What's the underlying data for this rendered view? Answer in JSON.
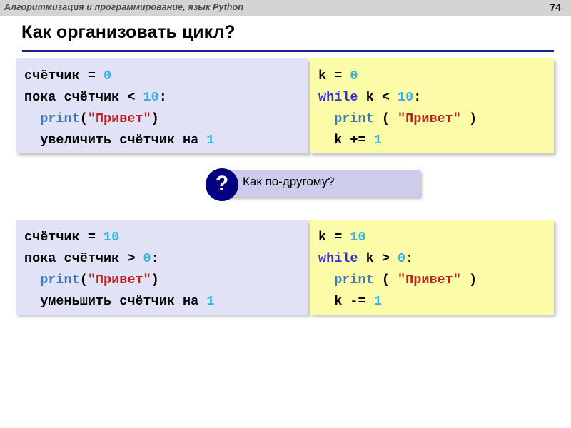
{
  "header": {
    "course": "Алгоритмизация и программирование, язык Python",
    "slide_number": "74"
  },
  "title": "Как организовать цикл?",
  "colors": {
    "header_bar": "#d4d4d4",
    "title_rule": "#1c1c8c",
    "pseudo_panel_bg": "#e2e2f7",
    "python_panel_bg": "#fbfba8",
    "badge_bg": "#000080",
    "bubble_bg": "#ccccec",
    "number_token": "#33b5e6",
    "keyword_token": "#3333cc",
    "function_token": "#3b7bbf",
    "string_token": "#c02020"
  },
  "callout": {
    "badge_glyph": "?",
    "text": "Как по-другому?"
  },
  "panels": {
    "pseudo_top": {
      "lines": [
        [
          {
            "t": "счётчик = ",
            "c": "plain"
          },
          {
            "t": "0",
            "c": "num"
          }
        ],
        [
          {
            "t": "пока счётчик < ",
            "c": "plain"
          },
          {
            "t": "10",
            "c": "num"
          },
          {
            "t": ":",
            "c": "plain"
          }
        ],
        [
          {
            "t": "  ",
            "c": "plain"
          },
          {
            "t": "print",
            "c": "fn"
          },
          {
            "t": "(",
            "c": "plain"
          },
          {
            "t": "\"Привет\"",
            "c": "str"
          },
          {
            "t": ")",
            "c": "plain"
          }
        ],
        [
          {
            "t": "  увеличить счётчик на ",
            "c": "plain"
          },
          {
            "t": "1",
            "c": "num"
          }
        ]
      ]
    },
    "python_top": {
      "lines": [
        [
          {
            "t": "k = ",
            "c": "plain"
          },
          {
            "t": "0",
            "c": "num"
          }
        ],
        [
          {
            "t": "while",
            "c": "kw"
          },
          {
            "t": " k < ",
            "c": "plain"
          },
          {
            "t": "10",
            "c": "num"
          },
          {
            "t": ":",
            "c": "plain"
          }
        ],
        [
          {
            "t": "  ",
            "c": "plain"
          },
          {
            "t": "print",
            "c": "fn"
          },
          {
            "t": " ( ",
            "c": "plain"
          },
          {
            "t": "\"Привет\"",
            "c": "str"
          },
          {
            "t": " )",
            "c": "plain"
          }
        ],
        [
          {
            "t": "  k += ",
            "c": "plain"
          },
          {
            "t": "1",
            "c": "num"
          }
        ]
      ]
    },
    "pseudo_bottom": {
      "lines": [
        [
          {
            "t": "счётчик = ",
            "c": "plain"
          },
          {
            "t": "10",
            "c": "num"
          }
        ],
        [
          {
            "t": "пока счётчик > ",
            "c": "plain"
          },
          {
            "t": "0",
            "c": "num"
          },
          {
            "t": ":",
            "c": "plain"
          }
        ],
        [
          {
            "t": "  ",
            "c": "plain"
          },
          {
            "t": "print",
            "c": "fn"
          },
          {
            "t": "(",
            "c": "plain"
          },
          {
            "t": "\"Привет\"",
            "c": "str"
          },
          {
            "t": ")",
            "c": "plain"
          }
        ],
        [
          {
            "t": "  уменьшить счётчик на ",
            "c": "plain"
          },
          {
            "t": "1",
            "c": "num"
          }
        ]
      ]
    },
    "python_bottom": {
      "lines": [
        [
          {
            "t": "k = ",
            "c": "plain"
          },
          {
            "t": "10",
            "c": "num"
          }
        ],
        [
          {
            "t": "while",
            "c": "kw"
          },
          {
            "t": " k > ",
            "c": "plain"
          },
          {
            "t": "0",
            "c": "num"
          },
          {
            "t": ":",
            "c": "plain"
          }
        ],
        [
          {
            "t": "  ",
            "c": "plain"
          },
          {
            "t": "print",
            "c": "fn"
          },
          {
            "t": " ( ",
            "c": "plain"
          },
          {
            "t": "\"Привет\"",
            "c": "str"
          },
          {
            "t": " )",
            "c": "plain"
          }
        ],
        [
          {
            "t": "  k -= ",
            "c": "plain"
          },
          {
            "t": "1",
            "c": "num"
          }
        ]
      ]
    }
  }
}
